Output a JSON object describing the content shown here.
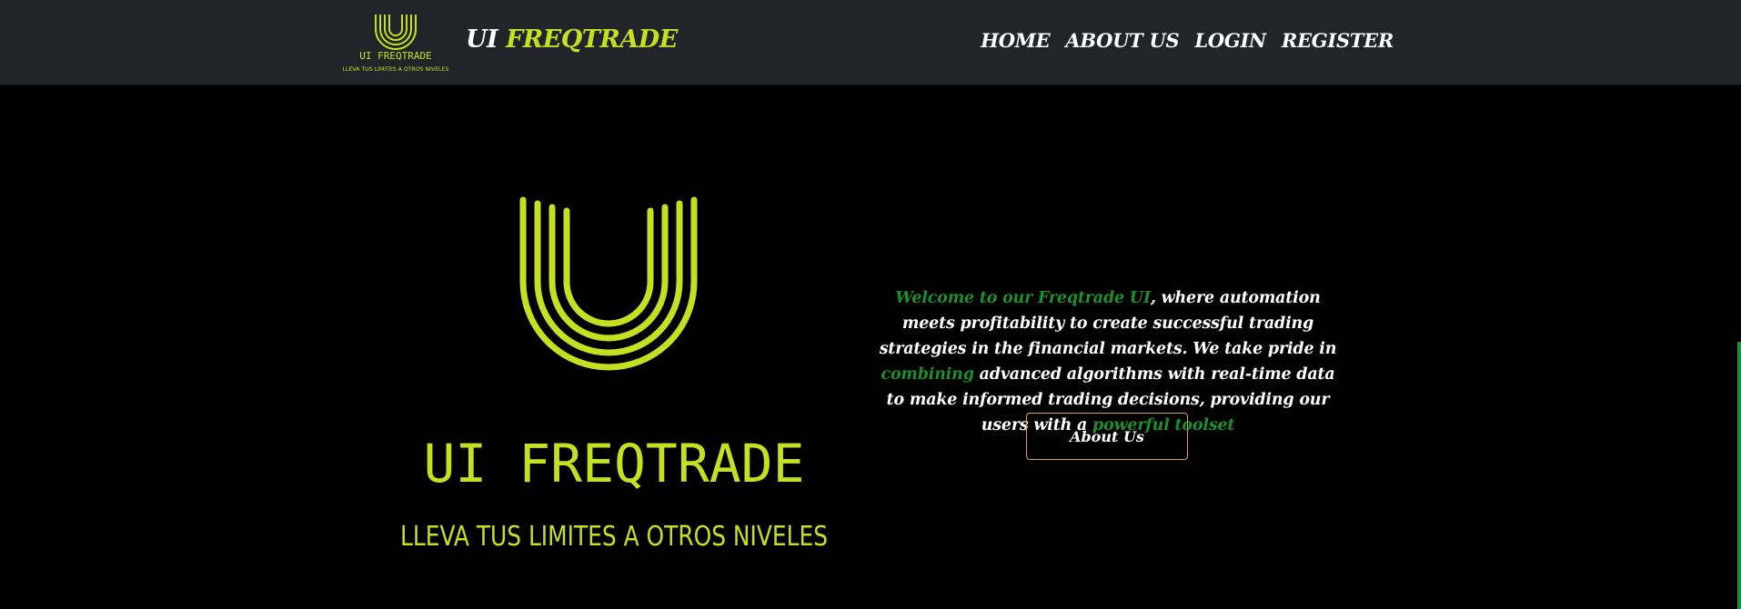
{
  "colors": {
    "navbar_bg": "#212429",
    "page_bg": "#000000",
    "brand_accent": "#c4e021",
    "text_green": "#1a8f2a",
    "button_border": "#d8a93a"
  },
  "navbar": {
    "logo_title": "UI FREQTRADE",
    "logo_tagline": "LLEVA TUS LIMITES A OTROS NIVELES",
    "brand_prefix": "UI",
    "brand_accent": "FREQTRADE",
    "links": [
      "HOME",
      "ABOUT US",
      "LOGIN",
      "REGISTER"
    ]
  },
  "hero": {
    "logo_title": "UI FREQTRADE",
    "logo_tagline": "LLEVA TUS LIMITES A OTROS NIVELES",
    "text_intro": "Welcome to our Freqtrade UI",
    "text_part1": ", where automation meets profitability to create successful trading strategies in the financial markets. We take pride in ",
    "text_highlight1": "combining",
    "text_part2": " advanced algorithms with real-time data to make informed trading decisions, providing our users with a ",
    "text_highlight2": "powerful toolset",
    "button_label": "About Us"
  }
}
